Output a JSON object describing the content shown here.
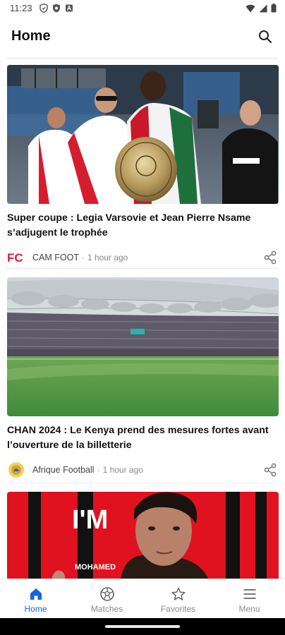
{
  "status_bar": {
    "time": "11:23",
    "left_icons": [
      "shield-icon",
      "shield-alt-icon",
      "a-square-icon"
    ],
    "right_icons": [
      "wifi-icon",
      "signal-icon",
      "battery-icon"
    ]
  },
  "header": {
    "title": "Home",
    "search_icon": "search-icon"
  },
  "articles": [
    {
      "title": "Super coupe : Legia Varsovie et Jean Pierre Nsame s’adjugent le trophée",
      "source": "CAM FOOT",
      "separator": "·",
      "time": "1 hour ago",
      "logo_text": "FC",
      "image": "football-players-with-trophy"
    },
    {
      "title": "CHAN 2024 : Le Kenya prend des mesures fortes avant l’ouverture de la billetterie",
      "source": "Afrique Football",
      "separator": "·",
      "time": "1 hour ago",
      "image": "stadium-pitch"
    },
    {
      "image_text": "I'M",
      "image_caption": "MOHAMED",
      "image": "player-portrait-red-banner"
    }
  ],
  "bottom_nav": [
    {
      "label": "Home",
      "icon": "home-icon",
      "active": true
    },
    {
      "label": "Matches",
      "icon": "soccer-ball-icon",
      "active": false
    },
    {
      "label": "Favorites",
      "icon": "star-icon",
      "active": false
    },
    {
      "label": "Menu",
      "icon": "menu-icon",
      "active": false
    }
  ],
  "colors": {
    "accent": "#1565d8",
    "brand_red": "#e11d2a"
  }
}
